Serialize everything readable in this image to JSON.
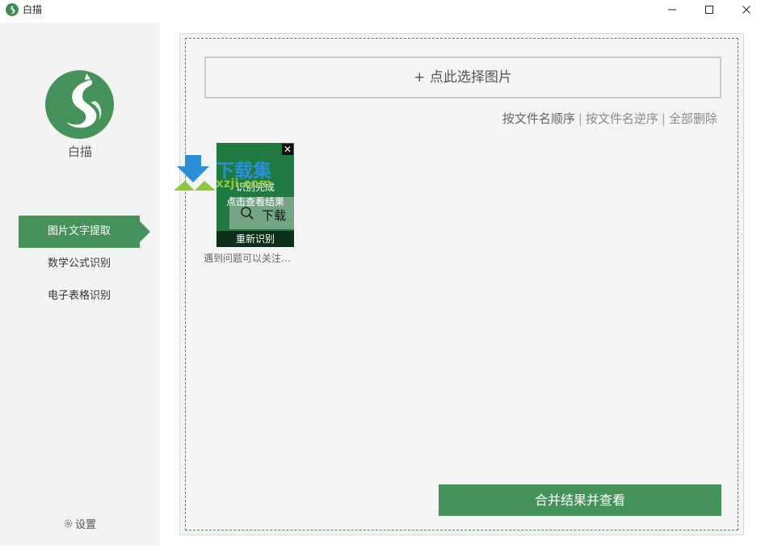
{
  "window": {
    "title": "白描",
    "controls": [
      "minimize-icon",
      "maximize-icon",
      "close-icon"
    ]
  },
  "sidebar": {
    "logo_text": "白描",
    "items": [
      {
        "label": "图片文字提取",
        "active": true
      },
      {
        "label": "数学公式识别",
        "active": false
      },
      {
        "label": "电子表格识别",
        "active": false
      }
    ],
    "settings_label": "设置",
    "settings_icon": "gear-icon"
  },
  "main": {
    "select_button": "+ 点此选择图片",
    "sort_links": [
      "按文件名顺序",
      "按文件名逆序",
      "全部删除"
    ],
    "sort_separator": "|",
    "thumbnails": [
      {
        "status": "识别完成",
        "view_label": "点击查看结果",
        "search_text": "下载",
        "retry_label": "重新识别",
        "close_glyph": "✕",
        "caption": "遇到问题可以关注…"
      }
    ],
    "merge_button": "合并结果并查看"
  },
  "watermark": {
    "text": "下载集",
    "sub": "xzji.com"
  },
  "colors": {
    "accent": "#45935a",
    "dashed_border": "#3f8c55",
    "panel_bg": "#f4f4f4",
    "sidebar_bg": "#f3f3f3"
  }
}
